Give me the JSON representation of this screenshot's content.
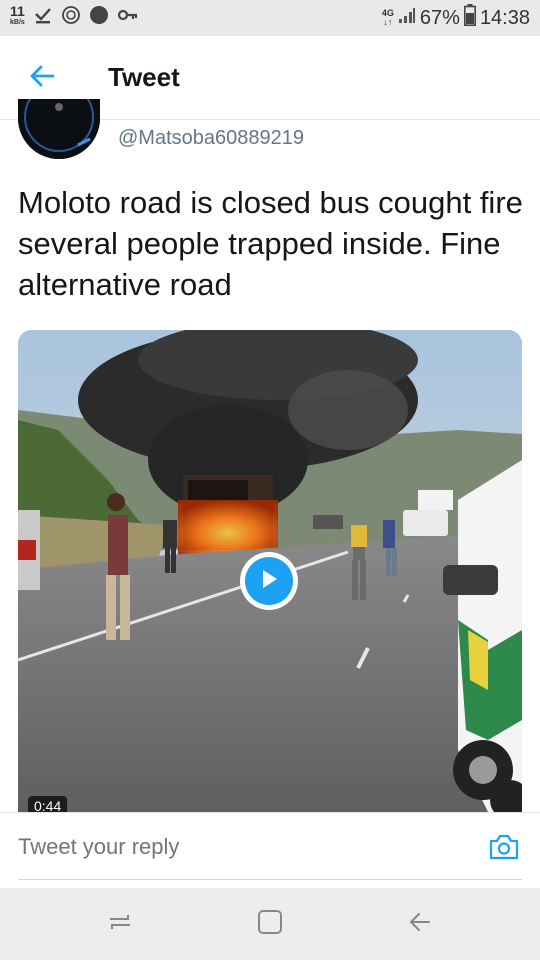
{
  "status_bar": {
    "speed_value": "11",
    "speed_unit": "kB/s",
    "network_type": "4G",
    "battery_percent": "67%",
    "time": "14:38",
    "icons": [
      "download-check-icon",
      "data-saver-icon",
      "dot-icon",
      "key-icon",
      "signal-icon",
      "battery-icon"
    ]
  },
  "header": {
    "title": "Tweet",
    "back_icon": "arrow-left-icon",
    "accent_color": "#1da1f2"
  },
  "tweet": {
    "handle": "@Matsoba60889219",
    "text": "Moloto road is closed bus cought fire several people trapped inside. Fine alternative road",
    "media": {
      "type": "video",
      "duration": "0:44",
      "play_icon": "play-icon"
    }
  },
  "reply": {
    "placeholder": "Tweet your reply",
    "camera_icon": "camera-icon"
  },
  "nav": {
    "icons": [
      "recent-apps-icon",
      "home-icon",
      "back-icon"
    ]
  }
}
